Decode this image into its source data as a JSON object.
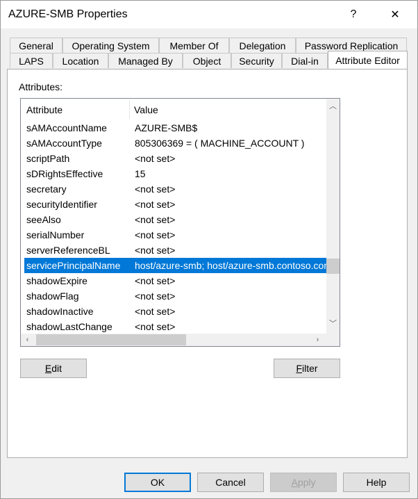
{
  "window": {
    "title": "AZURE-SMB Properties",
    "help_glyph": "?",
    "close_glyph": "✕"
  },
  "tabs": {
    "row1": [
      {
        "label": "General"
      },
      {
        "label": "Operating System"
      },
      {
        "label": "Member Of"
      },
      {
        "label": "Delegation"
      },
      {
        "label": "Password Replication"
      }
    ],
    "row2": [
      {
        "label": "LAPS"
      },
      {
        "label": "Location"
      },
      {
        "label": "Managed By"
      },
      {
        "label": "Object"
      },
      {
        "label": "Security"
      },
      {
        "label": "Dial-in"
      },
      {
        "label": "Attribute Editor"
      }
    ],
    "active": "Attribute Editor"
  },
  "attributes": {
    "label": "Attributes:",
    "columns": {
      "attribute": "Attribute",
      "value": "Value"
    },
    "rows": [
      {
        "attribute": "sAMAccountName",
        "value": "AZURE-SMB$"
      },
      {
        "attribute": "sAMAccountType",
        "value": "805306369 = ( MACHINE_ACCOUNT )"
      },
      {
        "attribute": "scriptPath",
        "value": "<not set>"
      },
      {
        "attribute": "sDRightsEffective",
        "value": "15"
      },
      {
        "attribute": "secretary",
        "value": "<not set>"
      },
      {
        "attribute": "securityIdentifier",
        "value": "<not set>"
      },
      {
        "attribute": "seeAlso",
        "value": "<not set>"
      },
      {
        "attribute": "serialNumber",
        "value": "<not set>"
      },
      {
        "attribute": "serverReferenceBL",
        "value": "<not set>"
      },
      {
        "attribute": "servicePrincipalName",
        "value": "host/azure-smb; host/azure-smb.contoso.com",
        "selected": true
      },
      {
        "attribute": "shadowExpire",
        "value": "<not set>"
      },
      {
        "attribute": "shadowFlag",
        "value": "<not set>"
      },
      {
        "attribute": "shadowInactive",
        "value": "<not set>"
      },
      {
        "attribute": "shadowLastChange",
        "value": "<not set>"
      }
    ],
    "vscroll_position": 0.76,
    "hscroll_visible_fraction": 0.5
  },
  "buttons": {
    "edit": {
      "label_pre": "",
      "label_ul": "E",
      "label_post": "dit"
    },
    "filter": {
      "label_pre": "",
      "label_ul": "F",
      "label_post": "ilter"
    },
    "ok": "OK",
    "cancel": "Cancel",
    "apply": {
      "label_pre": "",
      "label_ul": "A",
      "label_post": "pply"
    },
    "help": "Help"
  },
  "colors": {
    "selection": "#0078d7"
  }
}
